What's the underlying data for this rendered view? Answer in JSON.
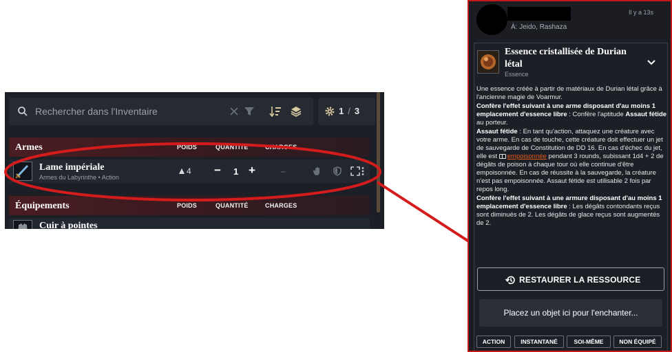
{
  "inventory": {
    "search_placeholder": "Rechercher dans l'Inventaire",
    "page_current": "1",
    "page_sep": "/",
    "page_total": "3",
    "sections": [
      {
        "title": "Armes",
        "columns": [
          "POIDS",
          "QUANTITÉ",
          "CHARGES"
        ],
        "items": [
          {
            "name": "Lame impériale",
            "subtitle": "Armes du Labyrinthe • Action",
            "weight": "4",
            "quantity": "1",
            "minus": "−",
            "plus": "+",
            "charges": "–"
          }
        ]
      },
      {
        "title": "Équipements",
        "columns": [
          "POIDS",
          "QUANTITÉ",
          "CHARGES"
        ],
        "items": [
          {
            "name": "Cuir à pointes"
          }
        ]
      }
    ]
  },
  "card": {
    "timestamp": "Il y a 13s",
    "recipients": "À: Jeido, Rashaza",
    "title": "Essence cristallisée de Durian létal",
    "subtitle": "Essence",
    "desc": {
      "p1": "Une essence créée à partir de matériaux de Durian létal grâce à l'ancienne magie de Voarmur.",
      "p2_bold": "Confère l'effet suivant à une arme disposant d'au moins 1 emplacement d'essence libre",
      "p2_a": " : Confère l'aptitude ",
      "p2_bold2": "Assaut fétide",
      "p2_b": " au porteur.",
      "p3_bold": "Assaut fétide",
      "p3_a": " : En tant qu'action, attaquez une créature avec votre arme. En cas de touche, cette créature doit effectuer un jet de sauvegarde de Constitution de DD 16. En cas d'échec du jet, elle est ",
      "p3_link": "empoisonnée",
      "p3_b": " pendant 3 rounds, subissant 1d4 + 2 de dégâts de poison à chaque tour où elle continue d'être empoisonnée. En cas de réussite à la sauvegarde, la créature n'est pas empoisonnée. Assaut fétide est utilisable 2 fois par repos long.",
      "p4_bold": "Confère l'effet suivant à une armure disposant d'au moins 1 emplacement d'essence libre",
      "p4_a": " : Les dégâts contondants reçus sont diminués de 2. Les dégâts de glace reçus sont augmentés de 2."
    },
    "restore_label": "RESTAURER LA RESSOURCE",
    "enchant_label": "Placez un objet ici pour l'enchanter...",
    "tags": [
      "ACTION",
      "INSTANTANÉ",
      "SOI-MÊME",
      "NON ÉQUIPÉ"
    ]
  },
  "colors": {
    "annotation": "#d41c1c",
    "panel_bg": "#1c1f25",
    "section_header": "#4a1d22",
    "link": "#e05a1a"
  }
}
